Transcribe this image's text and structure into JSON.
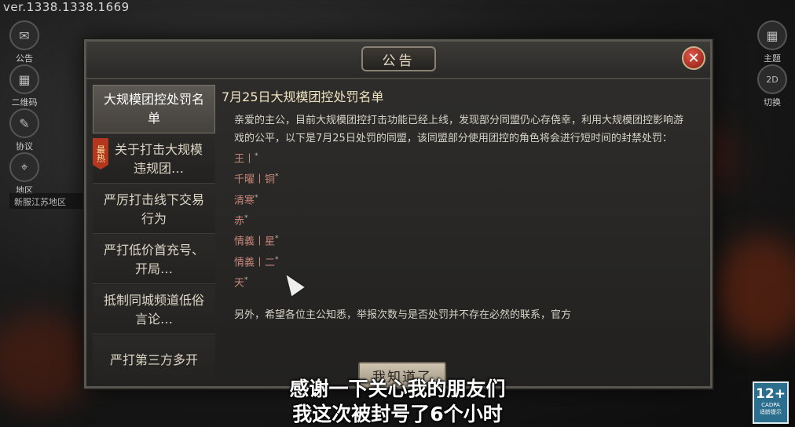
{
  "version": "ver.1338.1338.1669",
  "left_buttons": [
    {
      "label": "公告",
      "icon": "scroll-icon"
    },
    {
      "label": "二维码",
      "icon": "qrcode-icon"
    },
    {
      "label": "协议",
      "icon": "document-icon"
    },
    {
      "label": "地区",
      "icon": "map-icon"
    }
  ],
  "region_bar": "新服江苏地区",
  "right_buttons": [
    {
      "label": "主题",
      "icon": "grid-icon"
    },
    {
      "label": "切换",
      "icon": "2d3d-icon"
    }
  ],
  "dialog": {
    "title": "公告",
    "tabs": [
      {
        "label": "大规模团控处罚名单",
        "active": true,
        "hot": false
      },
      {
        "label": "关于打击大规模违规团…",
        "active": false,
        "hot": true,
        "badge": "最热"
      },
      {
        "label": "严厉打击线下交易行为",
        "active": false,
        "hot": false
      },
      {
        "label": "严打低价首充号、开局…",
        "active": false,
        "hot": false
      },
      {
        "label": "抵制同城频道低俗言论…",
        "active": false,
        "hot": false
      },
      {
        "label": "严打第三方多开",
        "active": false,
        "hot": false
      }
    ],
    "content_title": "7月25日大规模团控处罚名单",
    "paragraph1": "亲爱的主公，目前大规模团控打击功能已经上线，发现部分同盟仍心存侥幸，利用大规模团控影响游戏的公平，以下是7月25日处罚的同盟，该同盟部分使用团控的角色将会进行短时间的封禁处罚：",
    "names": [
      "王丨",
      "千曜丨铜",
      "清寒",
      "赤",
      "情義丨星",
      "情義丨二",
      "天"
    ],
    "paragraph2": "另外，希望各位主公知悉，举报次数与是否处罚并不存在必然的联系，官方",
    "ack_button": "我知道了"
  },
  "subtitles": [
    "感谢一下关心我的朋友们",
    "我这次被封号了6个小时"
  ],
  "age_rating": {
    "age": "12+",
    "org": "CADPA",
    "tip": "适龄提示"
  }
}
